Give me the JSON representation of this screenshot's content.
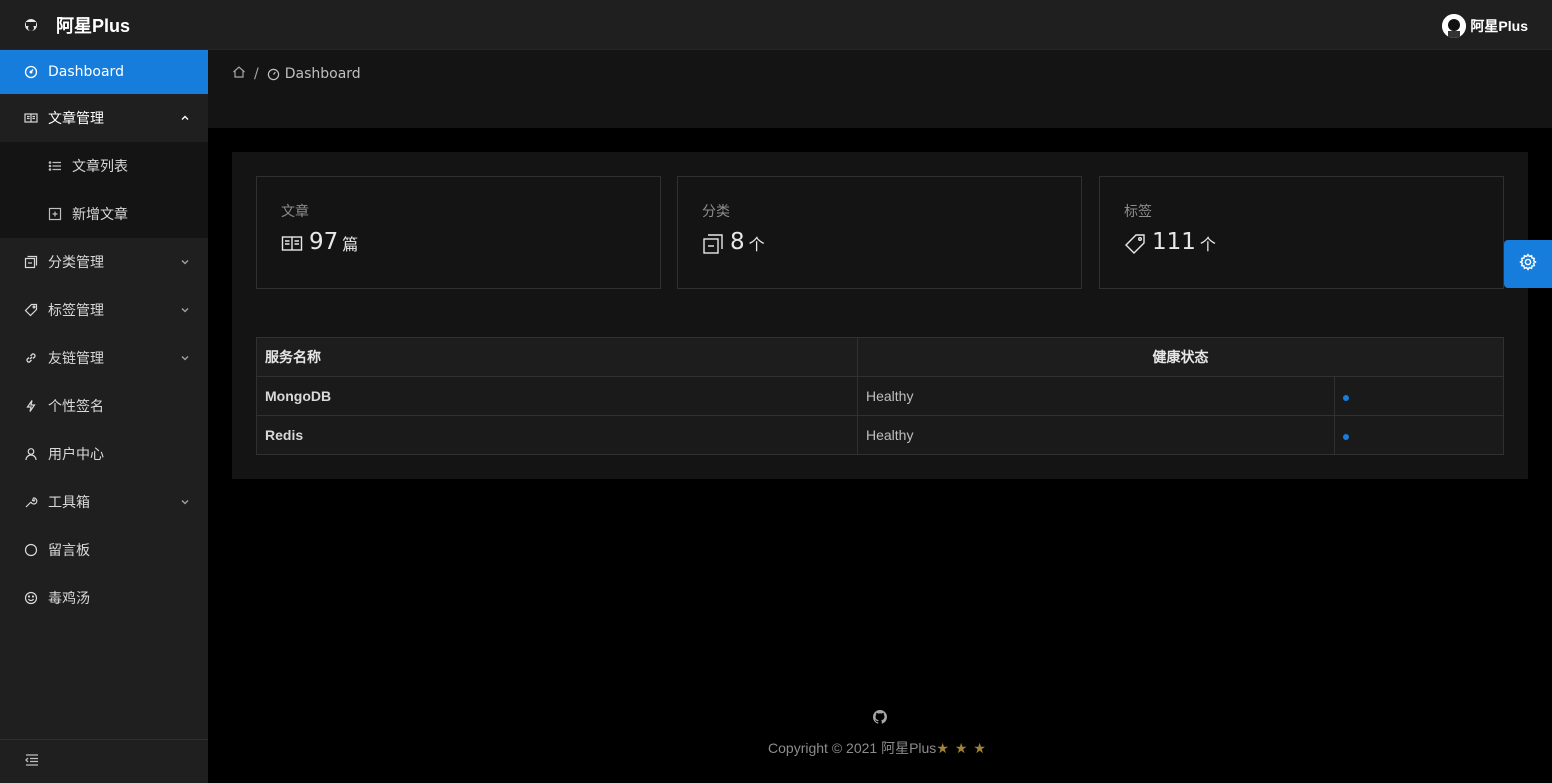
{
  "app": {
    "title": "阿星Plus"
  },
  "header": {
    "user_name": "阿星Plus"
  },
  "sidebar": {
    "items": [
      {
        "label": "Dashboard",
        "icon": "dashboard-icon",
        "active": true
      },
      {
        "label": "文章管理",
        "icon": "read-icon",
        "expanded": true,
        "children": [
          {
            "label": "文章列表",
            "icon": "unordered-list-icon"
          },
          {
            "label": "新增文章",
            "icon": "plus-square-icon"
          }
        ]
      },
      {
        "label": "分类管理",
        "icon": "block-icon"
      },
      {
        "label": "标签管理",
        "icon": "tag-icon"
      },
      {
        "label": "友链管理",
        "icon": "link-icon"
      },
      {
        "label": "个性签名",
        "icon": "thunderbolt-icon"
      },
      {
        "label": "用户中心",
        "icon": "user-icon"
      },
      {
        "label": "工具箱",
        "icon": "tool-icon"
      },
      {
        "label": "留言板",
        "icon": "message-icon"
      },
      {
        "label": "毒鸡汤",
        "icon": "smile-icon"
      }
    ]
  },
  "breadcrumb": {
    "current": "Dashboard",
    "separator": "/"
  },
  "stats": [
    {
      "title": "文章",
      "value": "97",
      "unit": "篇",
      "icon": "read-icon"
    },
    {
      "title": "分类",
      "value": "8",
      "unit": "个",
      "icon": "block-icon"
    },
    {
      "title": "标签",
      "value": "111",
      "unit": "个",
      "icon": "tag-icon"
    }
  ],
  "health_table": {
    "columns": [
      "服务名称",
      "健康状态"
    ],
    "rows": [
      {
        "name": "MongoDB",
        "status": "Healthy"
      },
      {
        "name": "Redis",
        "status": "Healthy"
      }
    ]
  },
  "footer": {
    "copyright": "Copyright © 2021 阿星Plus",
    "stars": "★★★"
  },
  "colors": {
    "accent": "#177ddc",
    "sider_bg": "#1f1f1f",
    "content_bg": "#141414",
    "star": "#a0843b"
  }
}
